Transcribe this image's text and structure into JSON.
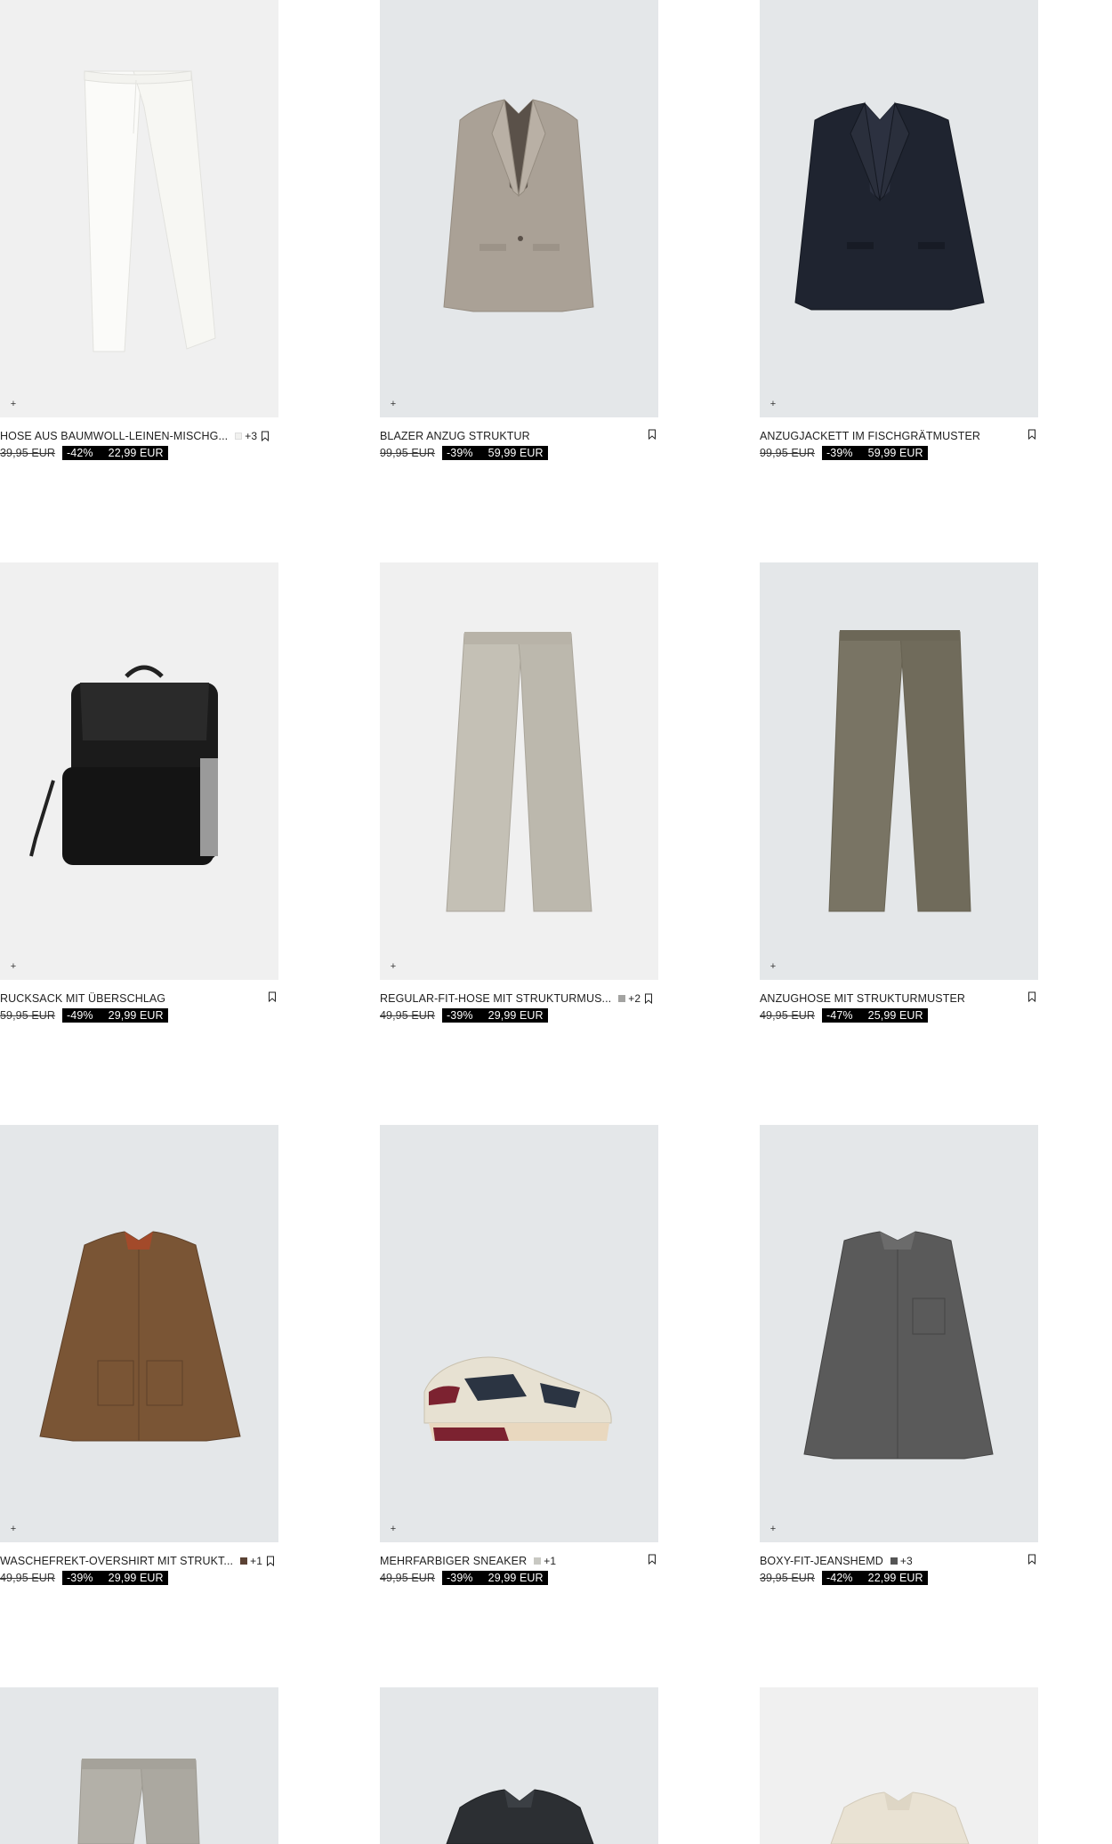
{
  "products": [
    {
      "name": "HOSE AUS BAUMWOLL-LEINEN-MISCHG...",
      "swatch_color": "#f1f1ef",
      "swatch_more": "+3",
      "old_price": "39,95 EUR",
      "discount": "-42%",
      "new_price": "22,99 EUR"
    },
    {
      "name": "BLAZER ANZUG STRUKTUR",
      "swatch_color": "",
      "swatch_more": "",
      "old_price": "99,95 EUR",
      "discount": "-39%",
      "new_price": "59,99 EUR"
    },
    {
      "name": "ANZUGJACKETT IM FISCHGRÄTMUSTER",
      "swatch_color": "",
      "swatch_more": "",
      "old_price": "99,95 EUR",
      "discount": "-39%",
      "new_price": "59,99 EUR"
    },
    {
      "name": "RUCKSACK MIT ÜBERSCHLAG",
      "swatch_color": "",
      "swatch_more": "",
      "old_price": "59,95 EUR",
      "discount": "-49%",
      "new_price": "29,99 EUR"
    },
    {
      "name": "REGULAR-FIT-HOSE MIT STRUKTURMUS...",
      "swatch_color": "#a3a3a1",
      "swatch_more": "+2",
      "old_price": "49,95 EUR",
      "discount": "-39%",
      "new_price": "29,99 EUR"
    },
    {
      "name": "ANZUGHOSE MIT STRUKTURMUSTER",
      "swatch_color": "",
      "swatch_more": "",
      "old_price": "49,95 EUR",
      "discount": "-47%",
      "new_price": "25,99 EUR"
    },
    {
      "name": "WASCHEFREKT-OVERSHIRT MIT STRUKT...",
      "swatch_color": "#5b4234",
      "swatch_more": "+1",
      "old_price": "49,95 EUR",
      "discount": "-39%",
      "new_price": "29,99 EUR"
    },
    {
      "name": "MEHRFARBIGER SNEAKER",
      "swatch_color": "#c8c8c2",
      "swatch_more": "+1",
      "old_price": "49,95 EUR",
      "discount": "-39%",
      "new_price": "29,99 EUR"
    },
    {
      "name": "BOXY-FIT-JEANSHEMD",
      "swatch_color": "#555555",
      "swatch_more": "+3",
      "old_price": "39,95 EUR",
      "discount": "-42%",
      "new_price": "22,99 EUR"
    }
  ],
  "icons": {
    "add": "plus-icon",
    "bookmark": "bookmark-icon"
  },
  "plus_glyph": "+"
}
